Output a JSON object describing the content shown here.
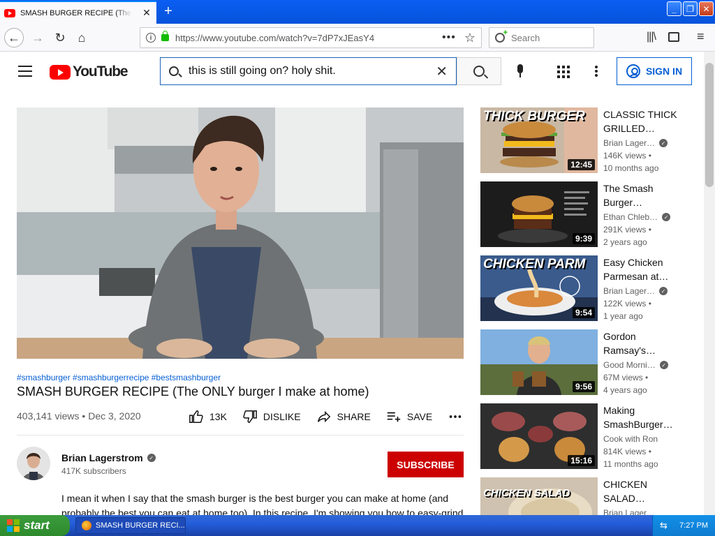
{
  "browser": {
    "tab_title": "SMASH BURGER RECIPE (The ONLY burger I make at home)",
    "url": "https://www.youtube.com/watch?v=7dP7xJEasY4",
    "search_placeholder": "Search"
  },
  "youtube": {
    "logo_text": "YouTube",
    "search_query": "this is still going on? holy shit.",
    "sign_in_label": "SIGN IN"
  },
  "video": {
    "hashtags": "#smashburger #smashburgerrecipe #bestsmashburger",
    "title": "SMASH BURGER RECIPE (The ONLY burger I make at home)",
    "views": "403,141 views",
    "date": "Dec 3, 2020",
    "like_count": "13K",
    "dislike_label": "DISLIKE",
    "share_label": "SHARE",
    "save_label": "SAVE"
  },
  "channel": {
    "name": "Brian Lagerstrom",
    "subscribers": "417K subscribers",
    "subscribe_label": "SUBSCRIBE"
  },
  "description": "I mean it when I say that the smash burger is the best burger you can make at home (and probably the best you can eat at home too). In this recipe, I'm showing you how to easy-grind",
  "recommendations": [
    {
      "title": "CLASSIC THICK GRILLED…",
      "channel": "Brian Lager…",
      "views": "146K views •",
      "ago": "10 months ago",
      "duration": "12:45",
      "caption": "THICK BURGER"
    },
    {
      "title": "The Smash Burger…",
      "channel": "Ethan Chleb…",
      "views": "291K views •",
      "ago": "2 years ago",
      "duration": "9:39",
      "caption": ""
    },
    {
      "title": "Easy Chicken Parmesan at…",
      "channel": "Brian Lager…",
      "views": "122K views •",
      "ago": "1 year ago",
      "duration": "9:54",
      "caption": "CHICKEN PARM"
    },
    {
      "title": "Gordon Ramsay's…",
      "channel": "Good Morni…",
      "views": "67M views •",
      "ago": "4 years ago",
      "duration": "9:56",
      "caption": ""
    },
    {
      "title": "Making SmashBurger…",
      "channel": "Cook with Ron",
      "views": "814K views •",
      "ago": "11 months ago",
      "duration": "15:16",
      "caption": ""
    },
    {
      "title": "CHICKEN SALAD…",
      "channel": "Brian Lager…",
      "views": "",
      "ago": "",
      "duration": "",
      "caption": "CHICKEN SALAD"
    }
  ],
  "taskbar": {
    "start_label": "start",
    "task_label": "SMASH BURGER RECI...",
    "clock": "7:27 PM"
  },
  "colors": {
    "youtube_red": "#ff0000",
    "subscribe_red": "#cc0000",
    "link_blue": "#065fd4",
    "xp_blue": "#245edb"
  }
}
